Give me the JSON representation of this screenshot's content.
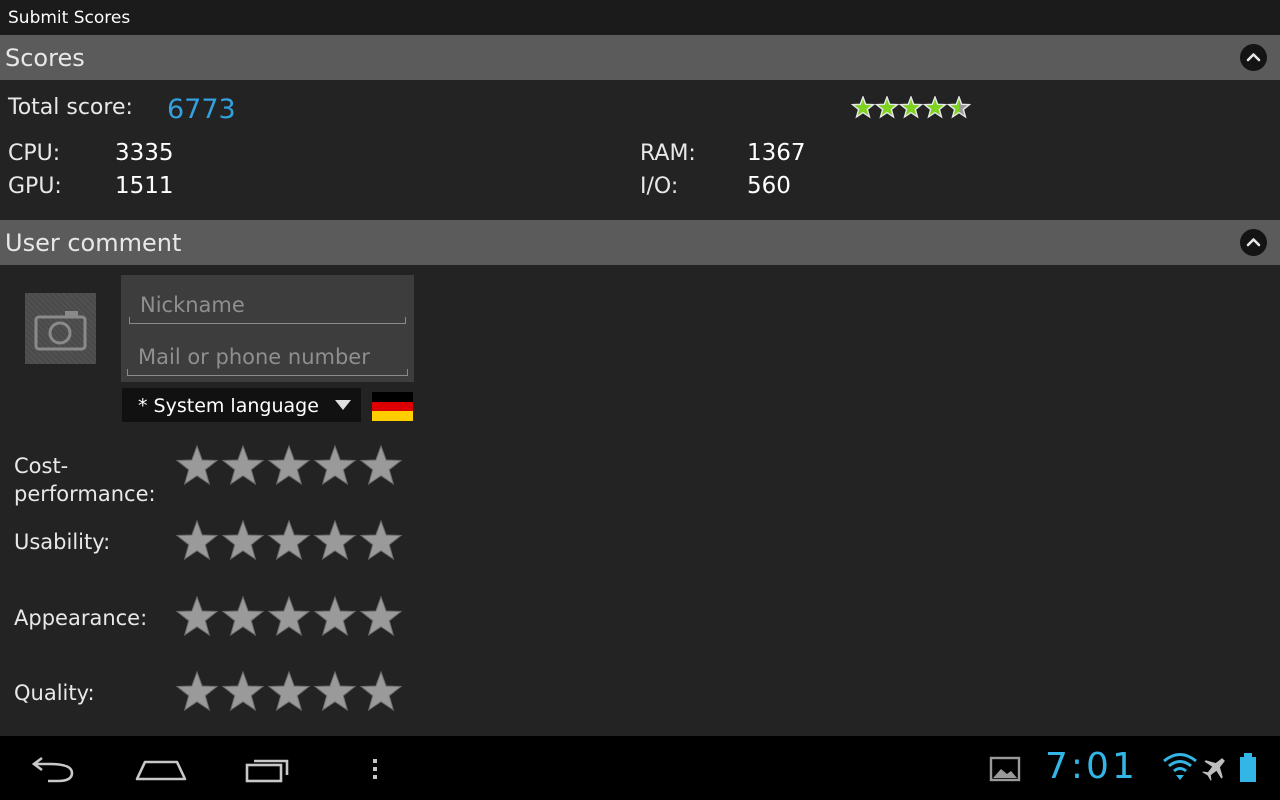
{
  "window": {
    "title": "Submit Scores"
  },
  "scores_section": {
    "title": "Scores",
    "total_label": "Total score:",
    "total_value": "6773",
    "star_rating": 4.5,
    "metrics": [
      {
        "label": "CPU:",
        "value": "3335"
      },
      {
        "label": "GPU:",
        "value": "1511"
      },
      {
        "label": "RAM:",
        "value": "1367"
      },
      {
        "label": "I/O:",
        "value": "560"
      }
    ]
  },
  "comment_section": {
    "title": "User comment",
    "nickname_placeholder": "Nickname",
    "contact_placeholder": "Mail or phone number",
    "language_select": "* System language",
    "flag_colors": [
      "#000000",
      "#dd0000",
      "#ffce00"
    ],
    "ratings": [
      {
        "label": "Cost-\nperformance:",
        "stars": 0
      },
      {
        "label": "Usability:",
        "stars": 0
      },
      {
        "label": "Appearance:",
        "stars": 0
      },
      {
        "label": "Quality:",
        "stars": 0
      }
    ]
  },
  "system_bar": {
    "clock": "7:01",
    "icons": [
      "back-icon",
      "home-icon",
      "recent-apps-icon",
      "menu-icon",
      "gallery-notification-icon",
      "wifi-icon",
      "airplane-mode-icon",
      "battery-icon"
    ]
  },
  "colors": {
    "accent": "#33a1e0",
    "clock": "#33b5e5",
    "star_filled": "#7ed321",
    "star_empty": "#9a9a9a"
  }
}
